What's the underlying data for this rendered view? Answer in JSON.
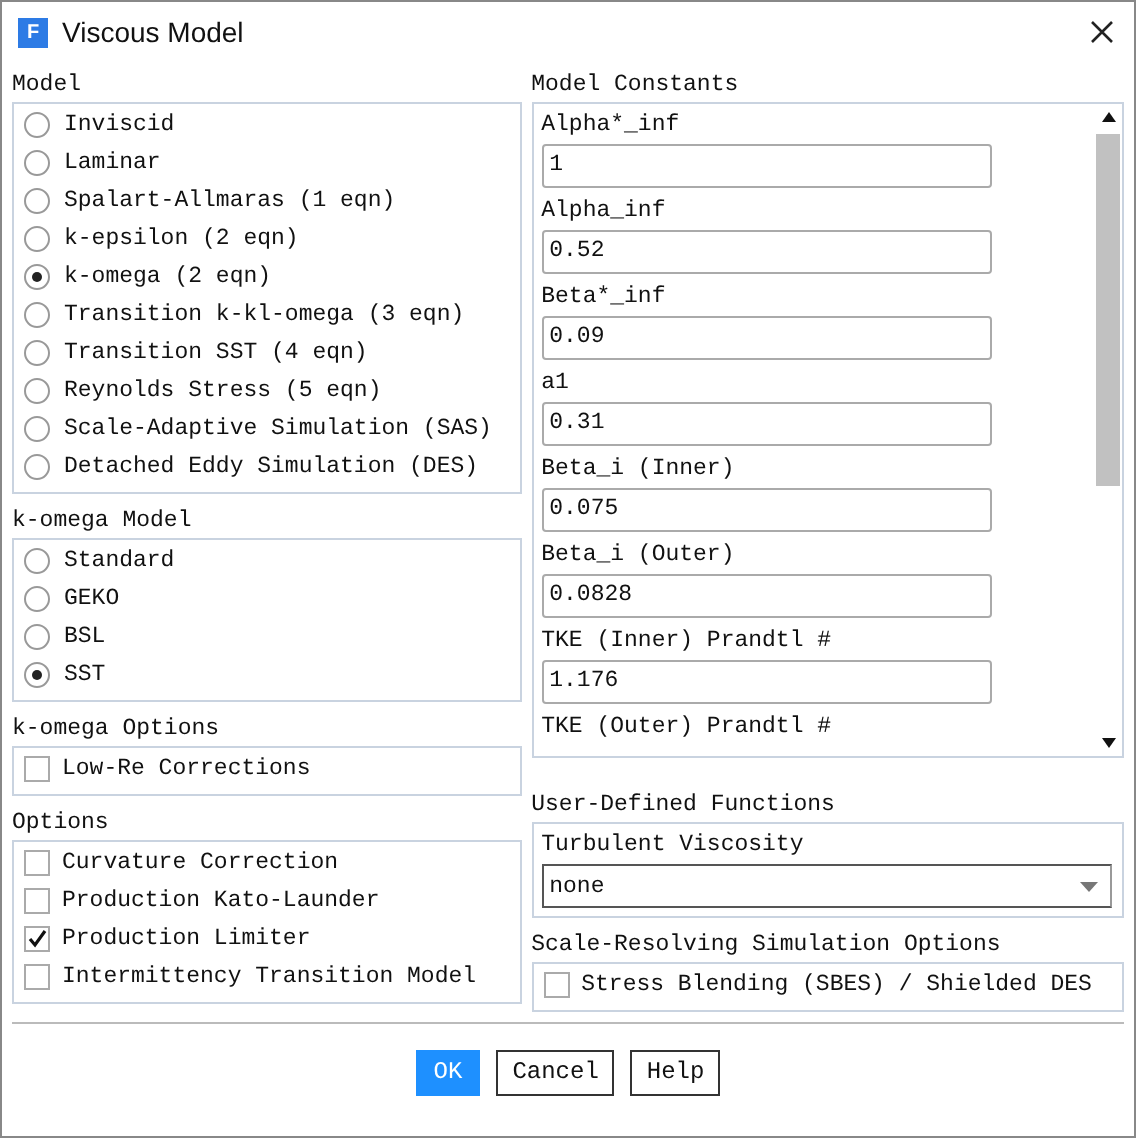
{
  "window": {
    "title": "Viscous Model",
    "app_icon": "F"
  },
  "model": {
    "label": "Model",
    "options": [
      {
        "label": "Inviscid",
        "selected": false
      },
      {
        "label": "Laminar",
        "selected": false
      },
      {
        "label": "Spalart-Allmaras (1 eqn)",
        "selected": false
      },
      {
        "label": "k-epsilon (2 eqn)",
        "selected": false
      },
      {
        "label": "k-omega (2 eqn)",
        "selected": true
      },
      {
        "label": "Transition k-kl-omega (3 eqn)",
        "selected": false
      },
      {
        "label": "Transition SST (4 eqn)",
        "selected": false
      },
      {
        "label": "Reynolds Stress (5 eqn)",
        "selected": false
      },
      {
        "label": "Scale-Adaptive Simulation (SAS)",
        "selected": false
      },
      {
        "label": "Detached Eddy Simulation (DES)",
        "selected": false
      }
    ]
  },
  "komega_model": {
    "label": "k-omega Model",
    "options": [
      {
        "label": "Standard",
        "selected": false
      },
      {
        "label": "GEKO",
        "selected": false
      },
      {
        "label": "BSL",
        "selected": false
      },
      {
        "label": "SST",
        "selected": true
      }
    ]
  },
  "komega_options": {
    "label": "k-omega Options",
    "options": [
      {
        "label": "Low-Re Corrections",
        "checked": false
      }
    ]
  },
  "options": {
    "label": "Options",
    "options": [
      {
        "label": "Curvature Correction",
        "checked": false
      },
      {
        "label": "Production Kato-Launder",
        "checked": false
      },
      {
        "label": "Production Limiter",
        "checked": true
      },
      {
        "label": "Intermittency Transition Model",
        "checked": false
      }
    ]
  },
  "model_constants": {
    "label": "Model Constants",
    "fields": [
      {
        "label": "Alpha*_inf",
        "value": "1"
      },
      {
        "label": "Alpha_inf",
        "value": "0.52"
      },
      {
        "label": "Beta*_inf",
        "value": "0.09"
      },
      {
        "label": "a1",
        "value": "0.31"
      },
      {
        "label": "Beta_i (Inner)",
        "value": "0.075"
      },
      {
        "label": "Beta_i (Outer)",
        "value": "0.0828"
      },
      {
        "label": "TKE (Inner) Prandtl #",
        "value": "1.176"
      },
      {
        "label": "TKE (Outer) Prandtl #"
      }
    ]
  },
  "udf": {
    "label": "User-Defined Functions",
    "field_label": "Turbulent Viscosity",
    "value": "none"
  },
  "srs": {
    "label": "Scale-Resolving Simulation Options",
    "options": [
      {
        "label": "Stress Blending (SBES) / Shielded DES",
        "checked": false
      }
    ]
  },
  "buttons": [
    {
      "label": "OK",
      "kind": "primary"
    },
    {
      "label": "Cancel",
      "kind": "normal"
    },
    {
      "label": "Help",
      "kind": "normal"
    }
  ]
}
